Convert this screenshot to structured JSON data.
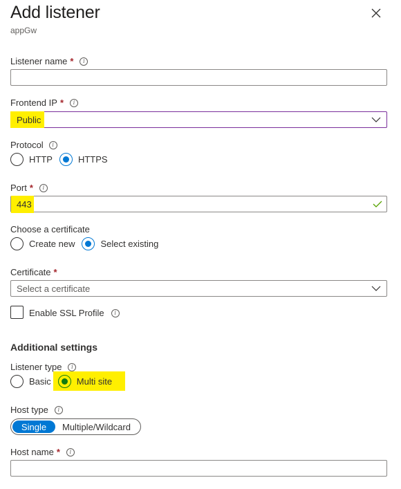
{
  "panel": {
    "title": "Add listener",
    "subtitle": "appGw",
    "close_icon": "close-icon"
  },
  "fields": {
    "listener_name": {
      "label": "Listener name",
      "required": "*",
      "value": ""
    },
    "frontend_ip": {
      "label": "Frontend IP",
      "required": "*",
      "value": "Public"
    },
    "protocol": {
      "label": "Protocol",
      "options": [
        "HTTP",
        "HTTPS"
      ],
      "selected": "HTTPS"
    },
    "port": {
      "label": "Port",
      "required": "*",
      "value": "443",
      "valid": true
    },
    "choose_certificate": {
      "label": "Choose a certificate",
      "options": [
        "Create new",
        "Select existing"
      ],
      "selected": "Select existing"
    },
    "certificate": {
      "label": "Certificate",
      "required": "*",
      "placeholder": "Select a certificate"
    },
    "ssl_profile": {
      "label": "Enable SSL Profile",
      "checked": false
    }
  },
  "additional_settings": {
    "heading": "Additional settings",
    "listener_type": {
      "label": "Listener type",
      "options": [
        "Basic",
        "Multi site"
      ],
      "selected": "Multi site"
    },
    "host_type": {
      "label": "Host type",
      "options": [
        "Single",
        "Multiple/Wildcard"
      ],
      "selected": "Single"
    },
    "host_name": {
      "label": "Host name",
      "required": "*",
      "value": ""
    }
  },
  "colors": {
    "accent": "#0078d4",
    "focus_border": "#7a2e9b",
    "highlight": "#ffef00",
    "required": "#a4262c",
    "valid_check": "#57a300",
    "selected_green": "#107c10"
  }
}
